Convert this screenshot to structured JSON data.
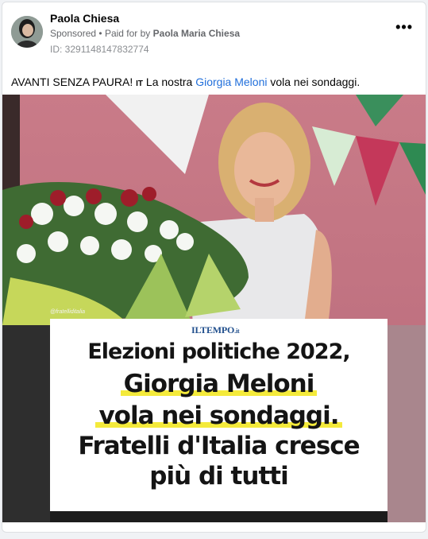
{
  "post": {
    "author": "Paola Chiesa",
    "sponsored": "Sponsored",
    "separator": "•",
    "paid_for_prefix": "Paid for by",
    "paid_for_name": "Paola Maria Chiesa",
    "ad_id": "ID: 3291148147832774",
    "more_label": "•••",
    "caption_part1": "AVANTI SENZA PAURA! ",
    "caption_flag": "IT",
    "caption_part2": " La nostra ",
    "caption_link": "Giorgia Meloni",
    "caption_part3": " vola nei sondaggi."
  },
  "image": {
    "watermark": "@fratelliditalia",
    "outlet": "ILTEMPO",
    "outlet_suffix": ".it",
    "headline_line1": "Elezioni politiche 2022,",
    "headline_line2": "Giorgia Meloni",
    "headline_line3": "vola nei sondaggi.",
    "headline_line4": "Fratelli d'Italia cresce",
    "headline_line5": "più di tutti"
  },
  "colors": {
    "link": "#216fdb",
    "highlight": "#f4ea3b",
    "outlet": "#1f4e8c"
  }
}
